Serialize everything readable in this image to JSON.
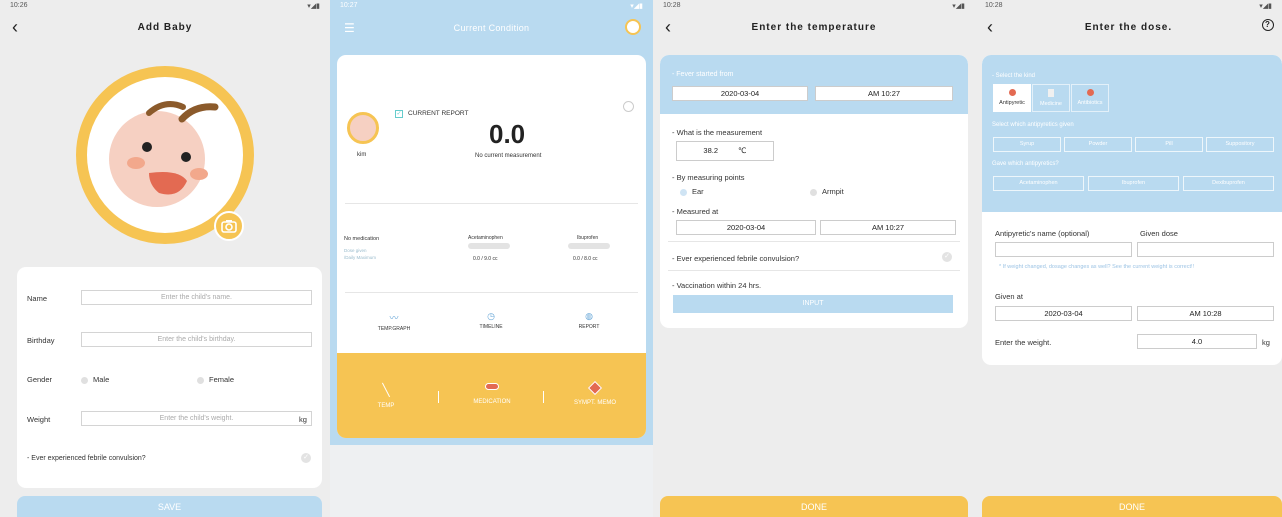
{
  "screen1": {
    "status_time": "10:26",
    "title": "Add Baby",
    "fields": [
      {
        "label": "Name",
        "placeholder": "Enter the child's name."
      },
      {
        "label": "Birthday",
        "placeholder": "Enter the child's birthday."
      },
      {
        "label": "Weight",
        "placeholder": "Enter the child's weight.",
        "unit": "kg"
      }
    ],
    "gender_label": "Gender",
    "gender_male": "Male",
    "gender_female": "Female",
    "convulsion_label": "- Ever experienced febrile convulsion?",
    "save_label": "SAVE"
  },
  "screen2": {
    "status_time": "10:27",
    "title": "Current Condition",
    "current_report": "CURRENT REPORT",
    "value": "0.0",
    "no_measurement": "No current measurement",
    "baby_name": "kim",
    "no_medication": "No medication",
    "dose_given": "Dose given",
    "daily_max": "/Daily Maximum",
    "meds": [
      {
        "name": "Acetaminophen",
        "dose": "0.0 / 9.0 cc"
      },
      {
        "name": "Ibuprofen",
        "dose": "0.0 / 8.0 cc"
      }
    ],
    "nav": [
      "TEMP.GRAPH",
      "TIMELINE",
      "REPORT"
    ],
    "actions": [
      "TEMP",
      "MEDICATION",
      "SYMPT. MEMO"
    ]
  },
  "screen3": {
    "status_time": "10:28",
    "title": "Enter the temperature",
    "fever_started": "- Fever started from",
    "date": "2020-03-04",
    "time": "AM 10:27",
    "measure_q": "- What is the measurement",
    "temp_value": "38.2",
    "temp_unit": "℃",
    "points_label": "- By measuring points",
    "point_ear": "Ear",
    "point_armpit": "Armpit",
    "measured_at": "- Measured at",
    "convulsion_q": "- Ever experienced febrile convulsion?",
    "vaccination": "- Vaccination within 24 hrs.",
    "input_label": "INPUT",
    "done_label": "DONE"
  },
  "screen4": {
    "status_time": "10:28",
    "title": "Enter the dose.",
    "select_kind": "- Select the kind",
    "kinds": [
      "Antipyretic",
      "Medicine",
      "Antibiotics"
    ],
    "which_given": "Select which antipyretics given",
    "forms": [
      "Syrup",
      "Powder",
      "Pill",
      "Suppository"
    ],
    "gave_which": "Gave which antipyretics?",
    "drugs": [
      "Acetaminophen",
      "Ibuprofen",
      "Dexibuprofen"
    ],
    "name_optional": "Antipyretic's name (optional)",
    "given_dose": "Given dose",
    "weight_note": "* If weight changed, dosage changes as well? See the current weight is correct!!",
    "given_at": "Given at",
    "date": "2020-03-04",
    "time": "AM 10:28",
    "weight_label": "Enter the weight.",
    "weight_value": "4.0",
    "weight_unit": "kg",
    "done_label": "DONE"
  },
  "colors": {
    "accent_blue": "#b9daf0",
    "accent_yellow": "#f6c453",
    "face_pink": "#f6d0c2",
    "hair_brown": "#8b5a2b"
  }
}
